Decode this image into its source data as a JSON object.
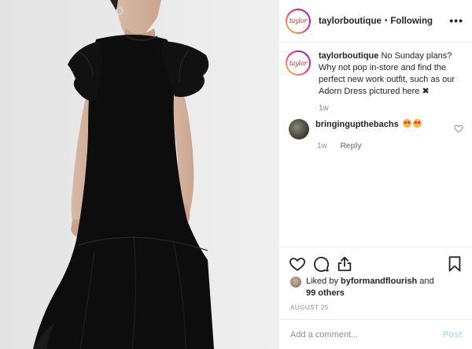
{
  "header": {
    "avatar_text": "taylor",
    "username": "taylorboutique",
    "separator": "•",
    "follow_status": "Following",
    "more": "•••"
  },
  "caption": {
    "avatar_text": "taylor",
    "username": "taylorboutique",
    "text": "No Sunday plans? Why not pop in-store and find the perfect new work outfit, such as our Adorn Dress pictured here",
    "symbol": "✖",
    "time": "1w"
  },
  "comment": {
    "username": "bringingupthebachs",
    "time": "1w",
    "reply_label": "Reply"
  },
  "likes": {
    "prefix": "Liked by",
    "user": "byformandflourish",
    "conjunction": "and",
    "others": "99 others"
  },
  "date": "AUGUST 25",
  "add_comment": {
    "placeholder": "Add a comment...",
    "post_label": "Post"
  },
  "colors": {
    "text": "#262626",
    "muted": "#8e8e8e",
    "post_disabled": "#b2dffc",
    "dress": "#0d0d0d"
  },
  "icons": [
    "heart-icon",
    "comment-icon",
    "share-icon",
    "bookmark-icon",
    "more-icon",
    "small-heart-icon"
  ]
}
